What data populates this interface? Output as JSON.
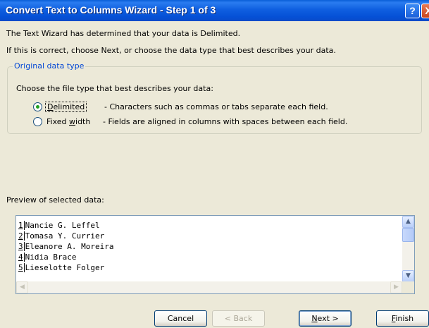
{
  "window": {
    "title": "Convert Text to Columns Wizard - Step 1 of 3",
    "help_glyph": "?",
    "close_glyph": "X"
  },
  "intro": {
    "line1": "The Text Wizard has determined that your data is Delimited.",
    "line2": "If this is correct, choose Next, or choose the data type that best describes your data."
  },
  "data_type": {
    "legend": "Original data type",
    "prompt": "Choose the file type that best describes your data:",
    "options": [
      {
        "label": "Delimited",
        "description": "- Characters such as commas or tabs separate each field.",
        "selected": true
      },
      {
        "label": "Fixed width",
        "description": "- Fields are aligned in columns with spaces between each field.",
        "selected": false
      }
    ]
  },
  "preview": {
    "label": "Preview of selected data:",
    "rows": [
      {
        "num": "1",
        "text": "Nancie G. Leffel"
      },
      {
        "num": "2",
        "text": "Tomasa Y. Currier"
      },
      {
        "num": "3",
        "text": "Eleanore A. Moreira"
      },
      {
        "num": "4",
        "text": "Nidia Brace"
      },
      {
        "num": "5",
        "text": "Lieselotte Folger"
      }
    ]
  },
  "buttons": {
    "cancel": "Cancel",
    "back": "< Back",
    "next": "Next >",
    "finish": "Finish"
  },
  "colors": {
    "title_bar": "#0a5fd8",
    "legend_text": "#0046d5",
    "radio_dot": "#21a121"
  }
}
